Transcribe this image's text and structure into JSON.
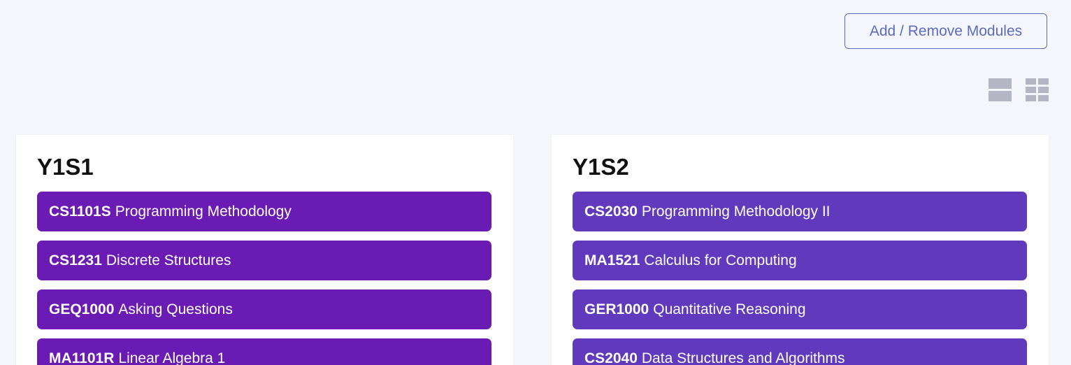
{
  "toolbar": {
    "add_remove_label": "Add / Remove Modules"
  },
  "view_toggle": {
    "icons": [
      "list-view-icon",
      "grid-view-icon"
    ],
    "color": "#b4b7c3"
  },
  "colors": {
    "background": "#f5f6fb",
    "button_accent": "#5c6bc0",
    "y1s1_module": "#6a1bb3",
    "y1s2_module": "#6139bd"
  },
  "semesters": [
    {
      "title": "Y1S1",
      "modules": [
        {
          "code": "CS1101S",
          "name": "Programming Methodology"
        },
        {
          "code": "CS1231",
          "name": "Discrete Structures"
        },
        {
          "code": "GEQ1000",
          "name": "Asking Questions"
        },
        {
          "code": "MA1101R",
          "name": "Linear Algebra 1"
        }
      ]
    },
    {
      "title": "Y1S2",
      "modules": [
        {
          "code": "CS2030",
          "name": "Programming Methodology II"
        },
        {
          "code": "MA1521",
          "name": "Calculus for Computing"
        },
        {
          "code": "GER1000",
          "name": "Quantitative Reasoning"
        },
        {
          "code": "CS2040",
          "name": "Data Structures and Algorithms"
        }
      ]
    }
  ]
}
